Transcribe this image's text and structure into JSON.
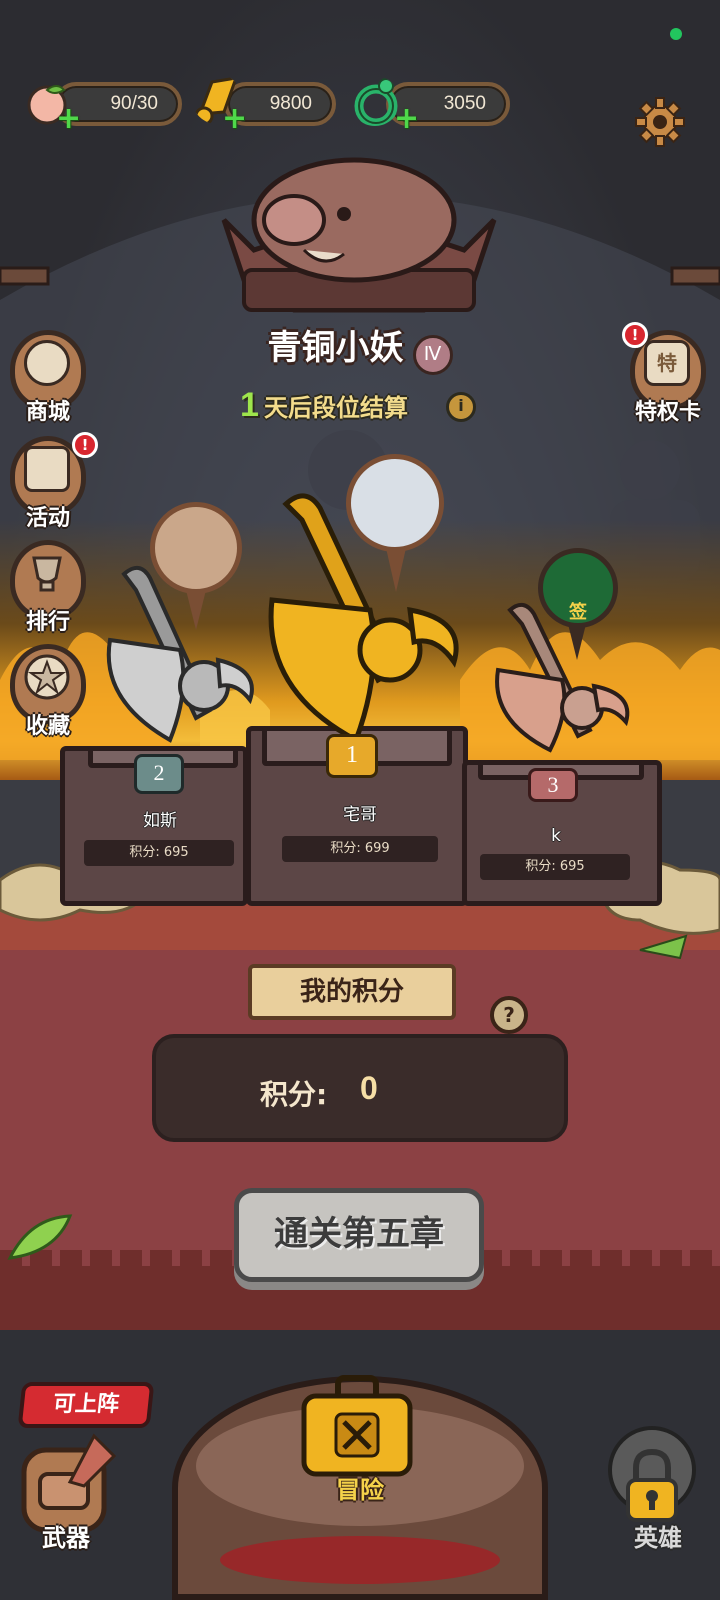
{
  "resources": [
    {
      "name": "peach-stamina",
      "value": "90/30"
    },
    {
      "name": "gold-coin",
      "value": "9800"
    },
    {
      "name": "jade-gem",
      "value": "3050"
    }
  ],
  "side_menu": [
    {
      "label": "商城",
      "alert": false
    },
    {
      "label": "活动",
      "alert": true
    },
    {
      "label": "排行",
      "alert": false
    },
    {
      "label": "收藏",
      "alert": false
    }
  ],
  "privilege_card": {
    "label": "特权卡",
    "alert": true,
    "icon_text": "特"
  },
  "alert_glyph": "!",
  "rank": {
    "title": "青铜小妖",
    "tier": "Ⅳ"
  },
  "season": {
    "days": "1",
    "text": "天后段位结算",
    "info_glyph": "i"
  },
  "podium": [
    {
      "rank": "2",
      "name": "如斯",
      "score": "积分: 695"
    },
    {
      "rank": "1",
      "name": "宅哥",
      "score": "积分: 699"
    },
    {
      "rank": "3",
      "name": "k",
      "score": "积分: 695",
      "avatar_text": "签"
    }
  ],
  "my_score": {
    "banner": "我的积分",
    "help_glyph": "?",
    "label": "积分:",
    "value": "0"
  },
  "stage_button": "通关第五章",
  "bottom_nav": {
    "weapon_badge": "可上阵",
    "weapon": "武器",
    "adventure": "冒险",
    "hero": "英雄"
  },
  "colors": {
    "gold": "#f0b421",
    "silver": "#b9b9b9",
    "bronze": "#d8a08c",
    "ground": "#8c4144",
    "accent_green": "#4fd84a",
    "alert_red": "#d8262f"
  }
}
